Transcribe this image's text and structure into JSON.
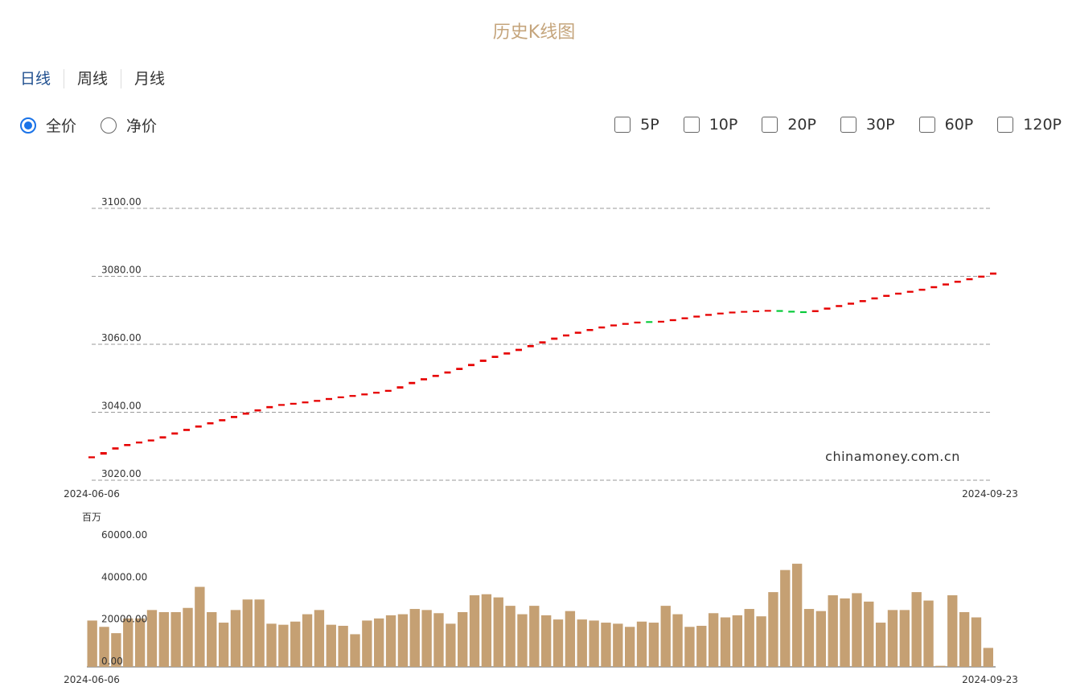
{
  "page_title": "历史K线图",
  "tabs": [
    {
      "label": "日线",
      "active": true
    },
    {
      "label": "周线",
      "active": false
    },
    {
      "label": "月线",
      "active": false
    }
  ],
  "price_mode": {
    "options": [
      {
        "label": "全价",
        "checked": true
      },
      {
        "label": "净价",
        "checked": false
      }
    ]
  },
  "ma_options": [
    "5P",
    "10P",
    "20P",
    "30P",
    "60P",
    "120P"
  ],
  "watermark": "chinamoney.com.cn",
  "colors": {
    "up": "#e60000",
    "down": "#00c834",
    "volume": "#c5a073",
    "grid": "#999999",
    "title": "#c5a57c",
    "accent": "#1a73e8"
  },
  "chart_data": [
    {
      "type": "candlestick",
      "title": "",
      "ylim": [
        3020,
        3100
      ],
      "yticks": [
        "3100.00",
        "3080.00",
        "3060.00",
        "3040.00",
        "3020.00"
      ],
      "ytick_values": [
        3100,
        3080,
        3060,
        3040,
        3020
      ],
      "x_range_labels": [
        "2024-06-06",
        "2024-09-23"
      ],
      "grid": true,
      "legend": "none",
      "close": [
        3027.0,
        3028.8,
        3029.9,
        3030.8,
        3031.4,
        3032.0,
        3033.2,
        3034.3,
        3035.3,
        3036.3,
        3037.2,
        3038.1,
        3039.1,
        3040.1,
        3041.0,
        3042.0,
        3042.3,
        3042.7,
        3043.1,
        3043.6,
        3044.2,
        3044.6,
        3045.0,
        3045.5,
        3046.0,
        3046.6,
        3048.0,
        3049.2,
        3050.2,
        3051.2,
        3052.2,
        3053.3,
        3054.5,
        3055.8,
        3056.8,
        3057.8,
        3058.9,
        3060.0,
        3061.1,
        3062.2,
        3063.0,
        3063.8,
        3064.6,
        3065.3,
        3065.8,
        3066.2,
        3066.6,
        3066.5,
        3066.8,
        3067.4,
        3067.9,
        3068.4,
        3068.9,
        3069.2,
        3069.5,
        3069.6,
        3069.8,
        3069.9,
        3069.7,
        3069.5,
        3069.4,
        3070.1,
        3070.9,
        3071.6,
        3072.3,
        3073.1,
        3073.9,
        3074.6,
        3075.2,
        3075.7,
        3076.4,
        3077.2,
        3078.0,
        3078.8,
        3079.5,
        3080.3,
        3081.3
      ],
      "volume_series": {
        "ylabel": "百万",
        "ylim": [
          0,
          60000
        ],
        "yticks": [
          "60000.00",
          "40000.00",
          "20000.00",
          "0.00"
        ],
        "ytick_values": [
          60000,
          40000,
          20000,
          0
        ],
        "x_range_labels": [
          "2024-06-06",
          "2024-09-23"
        ],
        "values": [
          22000,
          19000,
          16000,
          23000,
          23000,
          27000,
          26000,
          26000,
          28000,
          38000,
          26000,
          21000,
          27000,
          32000,
          32000,
          20500,
          20000,
          21500,
          25000,
          27000,
          20000,
          19500,
          15500,
          22000,
          23000,
          24500,
          25000,
          27500,
          27000,
          25500,
          20500,
          26000,
          34000,
          34500,
          33000,
          29000,
          25000,
          29000,
          24500,
          22500,
          26500,
          22500,
          22000,
          21000,
          20500,
          19000,
          21500,
          21000,
          29000,
          25000,
          19000,
          19500,
          25500,
          23500,
          24500,
          27500,
          24000,
          35500,
          46000,
          49000,
          27500,
          26500,
          34000,
          32500,
          35000,
          31000,
          21000,
          27000,
          27000,
          35500,
          31500,
          500,
          34000,
          26000,
          23500,
          9000
        ]
      }
    }
  ]
}
